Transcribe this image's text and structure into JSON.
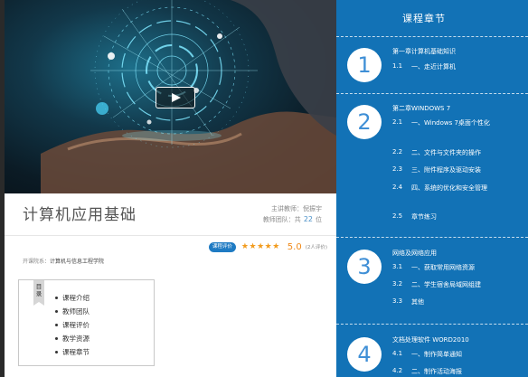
{
  "course": {
    "title": "计算机应用基础",
    "teacher_label": "主讲教师：",
    "teacher_name": "倪振宇",
    "team_prefix": "教师团队：共",
    "team_count": "22",
    "team_suffix": "位",
    "rating_badge": "课程评价",
    "rating_stars": 5,
    "score": "5.0",
    "rating_count": "(2人评价)",
    "institution_label": "开课院系：",
    "institution_name": "计算机与信息工程学院"
  },
  "toc": {
    "tag": "目录",
    "items": [
      "课程介绍",
      "教师团队",
      "课程评价",
      "教学资源",
      "课程章节"
    ]
  },
  "chapters_panel": {
    "title": "课程章节",
    "chapters": [
      {
        "number": "1",
        "title": "第一章计算机基础知识",
        "lessons": [
          {
            "num": "1.1",
            "text": "一、走近计算机"
          }
        ]
      },
      {
        "number": "2",
        "title": "第二章WINDOWS 7",
        "lessons": [
          {
            "num": "2.1",
            "text": "一、Windows 7桌面个性化"
          },
          {
            "num": "2.2",
            "text": "二、文件与文件夹的操作"
          },
          {
            "num": "2.3",
            "text": "三、附件程序及驱动安装"
          },
          {
            "num": "2.4",
            "text": "四、系统的优化和安全管理"
          },
          {
            "num": "2.5",
            "text": "章节练习"
          }
        ]
      },
      {
        "number": "3",
        "title": "网络及网络应用",
        "lessons": [
          {
            "num": "3.1",
            "text": "一、获取常用网络资源"
          },
          {
            "num": "3.2",
            "text": "二、学生宿舍局域网组建"
          },
          {
            "num": "3.3",
            "text": "其他"
          }
        ]
      },
      {
        "number": "4",
        "title": "文档处理软件 WORD2010",
        "lessons": [
          {
            "num": "4.1",
            "text": "一、制作简单通知"
          },
          {
            "num": "4.2",
            "text": "二、制作活动海报"
          }
        ]
      }
    ]
  },
  "colors": {
    "panel_bg": "#1272b6",
    "accent_blue": "#3f8fd6",
    "star_orange": "#f29b1d",
    "badge_blue": "#1f7bc3"
  },
  "icons": {
    "play": "play-icon",
    "star": "star-icon"
  }
}
